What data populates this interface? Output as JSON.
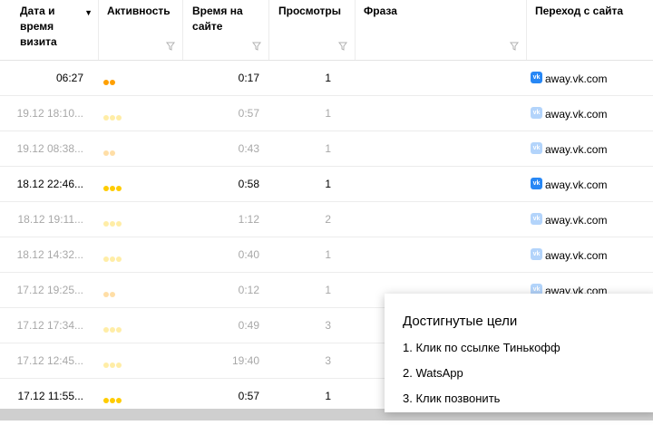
{
  "columns": {
    "date": "Дата и время визита",
    "activity": "Активность",
    "time": "Время на сайте",
    "views": "Просмотры",
    "phrase": "Фраза",
    "referrer": "Переход с сайта"
  },
  "vk_icon_text": "vk",
  "rows": [
    {
      "date": "06:27",
      "dots": 2,
      "dot_color": "#ffa000",
      "time": "0:17",
      "views": "1",
      "referrer": "away.vk.com",
      "dim": false
    },
    {
      "date": "19.12 18:10...",
      "dots": 3,
      "dot_color": "#ffcc00",
      "time": "0:57",
      "views": "1",
      "referrer": "away.vk.com",
      "dim": true
    },
    {
      "date": "19.12 08:38...",
      "dots": 2,
      "dot_color": "#ffa000",
      "time": "0:43",
      "views": "1",
      "referrer": "away.vk.com",
      "dim": true
    },
    {
      "date": "18.12 22:46...",
      "dots": 3,
      "dot_color": "#ffcc00",
      "time": "0:58",
      "views": "1",
      "referrer": "away.vk.com",
      "dim": false
    },
    {
      "date": "18.12 19:11...",
      "dots": 3,
      "dot_color": "#ffcc00",
      "time": "1:12",
      "views": "2",
      "referrer": "away.vk.com",
      "dim": true
    },
    {
      "date": "18.12 14:32...",
      "dots": 3,
      "dot_color": "#ffcc00",
      "time": "0:40",
      "views": "1",
      "referrer": "away.vk.com",
      "dim": true
    },
    {
      "date": "17.12 19:25...",
      "dots": 2,
      "dot_color": "#ffa000",
      "time": "0:12",
      "views": "1",
      "referrer": "away.vk.com",
      "dim": true
    },
    {
      "date": "17.12 17:34...",
      "dots": 3,
      "dot_color": "#ffcc00",
      "time": "0:49",
      "views": "3",
      "referrer": "",
      "dim": true
    },
    {
      "date": "17.12 12:45...",
      "dots": 3,
      "dot_color": "#ffcc00",
      "time": "19:40",
      "views": "3",
      "referrer": "",
      "dim": true
    },
    {
      "date": "17.12 11:55...",
      "dots": 3,
      "dot_color": "#ffcc00",
      "time": "0:57",
      "views": "1",
      "referrer": "",
      "dim": false
    }
  ],
  "tooltip": {
    "title": "Достигнутые цели",
    "goals": [
      "1. Клик по ссылке Тинькофф",
      "2. WatsApp",
      "3. Клик позвонить"
    ]
  }
}
